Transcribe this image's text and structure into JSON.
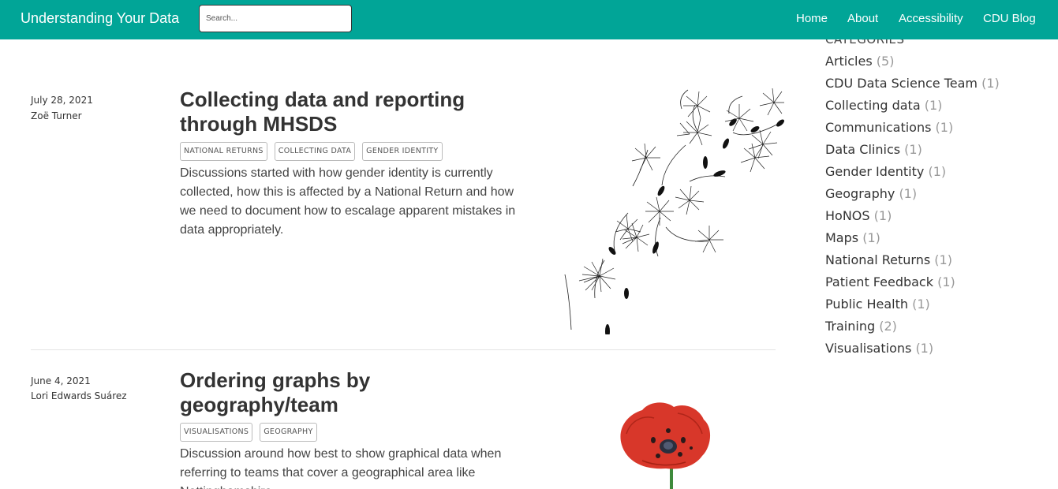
{
  "navbar": {
    "brand": "Understanding Your Data",
    "search_placeholder": "Search...",
    "links": [
      "Home",
      "About",
      "Accessibility",
      "CDU Blog"
    ]
  },
  "sidebar": {
    "heading": "CATEGORIES",
    "categories": [
      {
        "name": "Articles",
        "count": "(5)"
      },
      {
        "name": "CDU Data Science Team",
        "count": "(1)"
      },
      {
        "name": "Collecting data",
        "count": "(1)"
      },
      {
        "name": "Communications",
        "count": "(1)"
      },
      {
        "name": "Data Clinics",
        "count": "(1)"
      },
      {
        "name": "Gender Identity",
        "count": "(1)"
      },
      {
        "name": "Geography",
        "count": "(1)"
      },
      {
        "name": "HoNOS",
        "count": "(1)"
      },
      {
        "name": "Maps",
        "count": "(1)"
      },
      {
        "name": "National Returns",
        "count": "(1)"
      },
      {
        "name": "Patient Feedback",
        "count": "(1)"
      },
      {
        "name": "Public Health",
        "count": "(1)"
      },
      {
        "name": "Training",
        "count": "(2)"
      },
      {
        "name": "Visualisations",
        "count": "(1)"
      }
    ]
  },
  "posts": [
    {
      "date": "July 28, 2021",
      "author": "Zoë Turner",
      "title": "Collecting data and reporting through MHSDS",
      "tags": [
        "NATIONAL RETURNS",
        "COLLECTING DATA",
        "GENDER IDENTITY"
      ],
      "description": "Discussions started with how gender identity is currently collected, how this is affected by a National Return and how we need to document how to escalage apparent mistakes in data appropriately.",
      "image": "dandelion-seeds"
    },
    {
      "date": "June 4, 2021",
      "author": "Lori Edwards Suárez",
      "title": "Ordering graphs by geography/team",
      "tags": [
        "VISUALISATIONS",
        "GEOGRAPHY"
      ],
      "description": "Discussion around how best to show graphical data when referring to teams that cover a geographical area like Nottinghamshire.",
      "image": "red-poppy"
    }
  ],
  "colors": {
    "navbar": "#01a597",
    "poppy": "#d8372a"
  }
}
